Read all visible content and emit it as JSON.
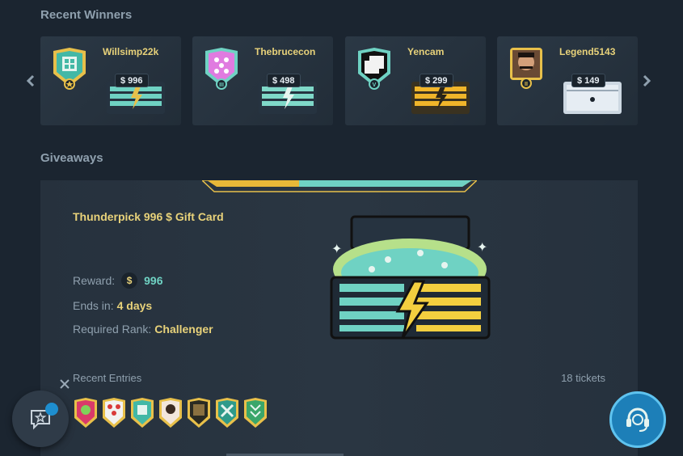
{
  "recent_winners": {
    "title": "Recent Winners",
    "winners": [
      {
        "name": "Willsimp22k",
        "amount": "$ 996",
        "name_color": "#e8d27a",
        "chest": "teal"
      },
      {
        "name": "Thebrucecon",
        "amount": "$ 498",
        "name_color": "#e8d27a",
        "chest": "teal"
      },
      {
        "name": "Yencam",
        "amount": "$ 299",
        "name_color": "#e8d27a",
        "chest": "gold"
      },
      {
        "name": "Legend5143",
        "amount": "$ 149",
        "name_color": "#e8d27a",
        "chest": "silver"
      }
    ],
    "prev_icon": "chevron-left-icon",
    "next_icon": "chevron-right-icon"
  },
  "giveaways": {
    "title": "Giveaways",
    "card": {
      "title": "Thunderpick 996 $ Gift Card",
      "reward_label": "Reward:",
      "reward_currency": "$",
      "reward_value": "996",
      "ends_label": "Ends in:",
      "ends_value": "4 days",
      "rank_label": "Required Rank:",
      "rank_value": "Challenger",
      "entries_label": "Recent Entries",
      "tickets": "18 tickets"
    }
  },
  "colors": {
    "accent_gold": "#e8d27a",
    "accent_teal": "#6fd2c3",
    "support_blue": "#1d7fb8"
  }
}
